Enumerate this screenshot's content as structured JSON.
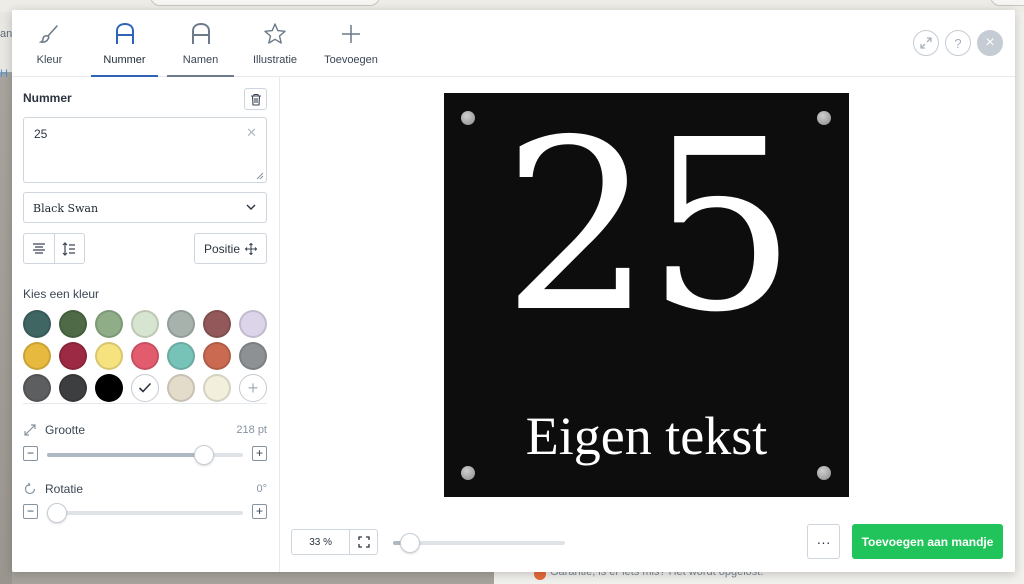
{
  "background": {
    "left_text_1": "an",
    "left_text_2": "H",
    "bottom_text": "Garantie, is er iets mis? Het wordt opgelost."
  },
  "tabs": [
    {
      "label": "Kleur",
      "icon": "brush-icon"
    },
    {
      "label": "Nummer",
      "icon": "letter-a-icon",
      "active": true
    },
    {
      "label": "Namen",
      "icon": "letter-a-icon"
    },
    {
      "label": "Illustratie",
      "icon": "star-icon"
    },
    {
      "label": "Toevoegen",
      "icon": "plus-icon"
    }
  ],
  "header_buttons": [
    "expand-icon",
    "help-icon",
    "close-icon"
  ],
  "panel": {
    "title": "Nummer",
    "text_value": "25",
    "font_select": "Black Swan",
    "position_label": "Positie",
    "color_label": "Kies een kleur",
    "swatches": [
      "#3f6663",
      "#4f6a46",
      "#8fad87",
      "#d7e4cf",
      "#a8b2ad",
      "#93595a",
      "#dcd5ea",
      "#e7b93f",
      "#9c2a44",
      "#f6e27f",
      "#e35c6e",
      "#78c3b7",
      "#c96a51",
      "#8e9193",
      "#5c5e60",
      "#3d3e40",
      "#000000",
      "#ffffff",
      "#e4dccb",
      "#f2efdd"
    ],
    "selected_swatch": "#ffffff",
    "size_label": "Grootte",
    "size_value": "218 pt",
    "size_fraction": 0.8,
    "rotation_label": "Rotatie",
    "rotation_value": "0°",
    "rotation_fraction": 0.0
  },
  "preview": {
    "number": "25",
    "text": "Eigen tekst",
    "plate_color": "#0d0d0d",
    "text_color": "#ffffff"
  },
  "toolbar": {
    "zoom_value": "33 %",
    "zoom_fraction": 0.1,
    "more_label": "···",
    "cart_label": "Toevoegen aan mandje"
  },
  "colors": {
    "accent": "#2f63b8",
    "cart_button": "#21c45a"
  }
}
